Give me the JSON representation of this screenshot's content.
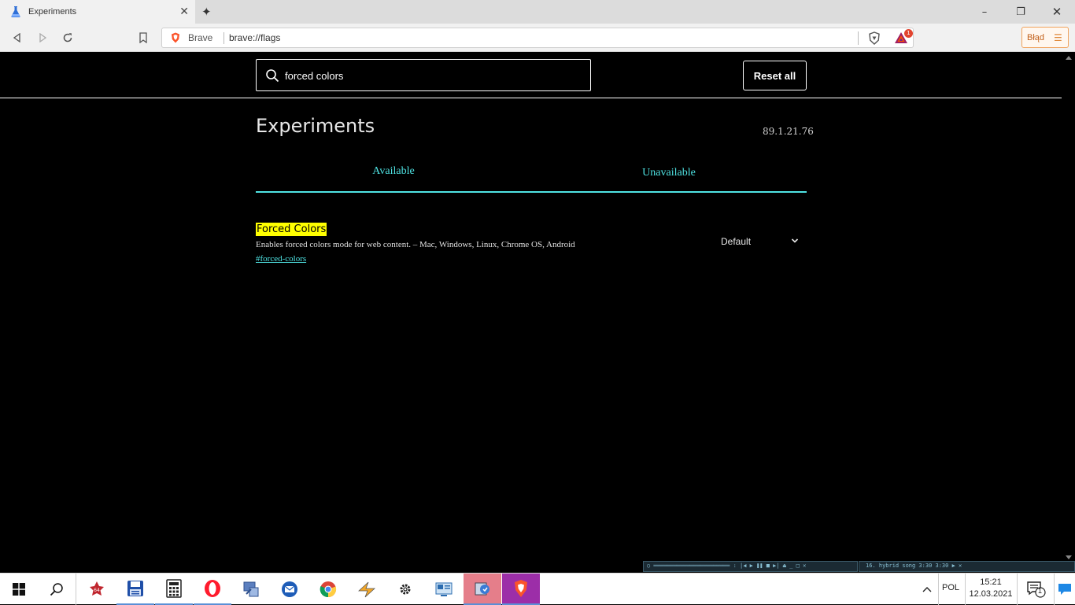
{
  "tab": {
    "title": "Experiments",
    "close": "✕",
    "new": "✦"
  },
  "window": {
    "minimize": "–",
    "maximize": "❐",
    "close": "✕"
  },
  "toolbar": {
    "site_label": "Brave",
    "url": "brave://flags",
    "rewards_badge": "1",
    "error_label": "Błąd",
    "menu_glyph": "☰"
  },
  "page": {
    "search_value": "forced colors",
    "reset_label": "Reset all",
    "title": "Experiments",
    "version": "89.1.21.76",
    "tabs": [
      "Available",
      "Unavailable"
    ]
  },
  "experiment": {
    "name": "Forced Colors",
    "description": "Enables forced colors mode for web content. – Mac, Windows, Linux, Chrome OS, Android",
    "link": "#forced-colors",
    "value": "Default"
  },
  "mini_players": {
    "left_text": "○ ═══════════════════════ :  |◀ ▶ ❚❚ ■ ▶| ⏏    _ □ ✕",
    "right_text": "16. hybrid song 3:30                   3:30 ▶ ✕"
  },
  "tray": {
    "language": "POL",
    "time": "15:21",
    "date": "12.03.2021",
    "notification_count": "1"
  },
  "colors": {
    "accent": "#4fe3e3",
    "highlight": "#ffff00",
    "brave_orange": "#fb542b"
  }
}
